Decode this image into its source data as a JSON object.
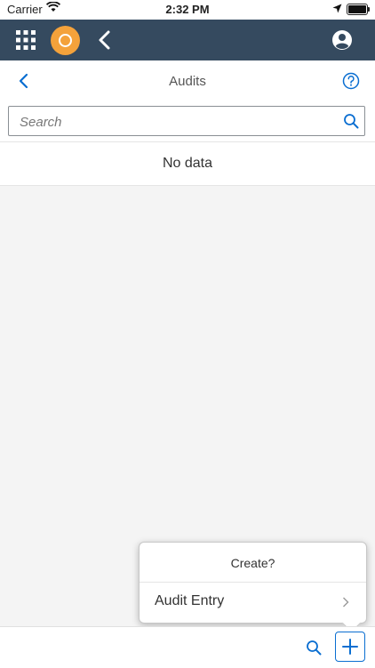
{
  "status_bar": {
    "carrier": "Carrier",
    "time": "2:32 PM"
  },
  "shell": {
    "icons": [
      "app-grid-icon",
      "company-logo",
      "back-chevron-icon",
      "profile-icon"
    ]
  },
  "page": {
    "title": "Audits"
  },
  "search": {
    "placeholder": "Search",
    "value": ""
  },
  "list": {
    "empty_text": "No data"
  },
  "popover": {
    "title": "Create?",
    "items": [
      {
        "label": "Audit Entry"
      }
    ]
  },
  "colors": {
    "shell_background": "#354a5f",
    "logo_accent": "#f4a23b",
    "link_blue": "#0a6ed1"
  }
}
